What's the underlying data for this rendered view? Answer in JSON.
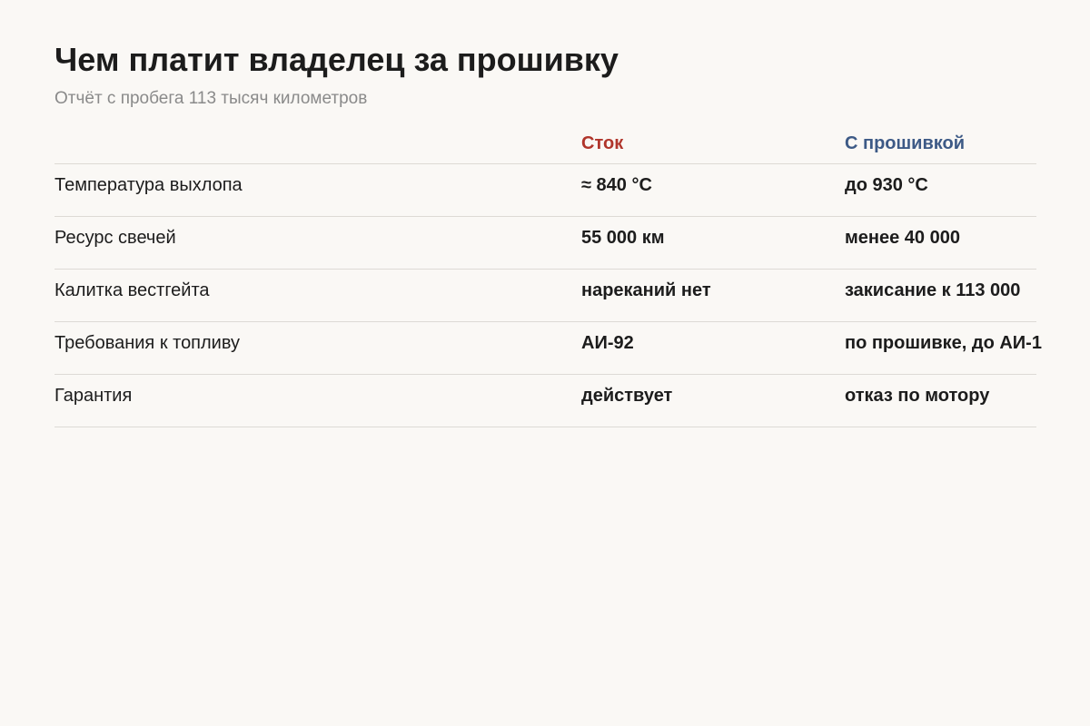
{
  "header": {
    "title": "Чем платит владелец за прошивку",
    "subtitle": "Отчёт с пробега 113 тысяч километров"
  },
  "table": {
    "columns": {
      "stock": "Сток",
      "tuned": "С прошивкой"
    },
    "rows": [
      {
        "label": "Температура выхлопа",
        "stock": "≈ 840 °C",
        "tuned": "до 930 °C"
      },
      {
        "label": "Ресурс свечей",
        "stock": "55 000 км",
        "tuned": "менее 40 000"
      },
      {
        "label": "Калитка вестгейта",
        "stock": "нареканий нет",
        "tuned": "закисание к 113 000"
      },
      {
        "label": "Требования к топливу",
        "stock": "АИ-92",
        "tuned": "по прошивке, до АИ-1"
      },
      {
        "label": "Гарантия",
        "stock": "действует",
        "tuned": "отказ по мотору"
      }
    ]
  },
  "colors": {
    "stock_accent": "#b0352b",
    "tuned_accent": "#3d5a86",
    "background": "#faf8f5",
    "divider": "#dddad5",
    "subtitle": "#8a8a8a"
  }
}
